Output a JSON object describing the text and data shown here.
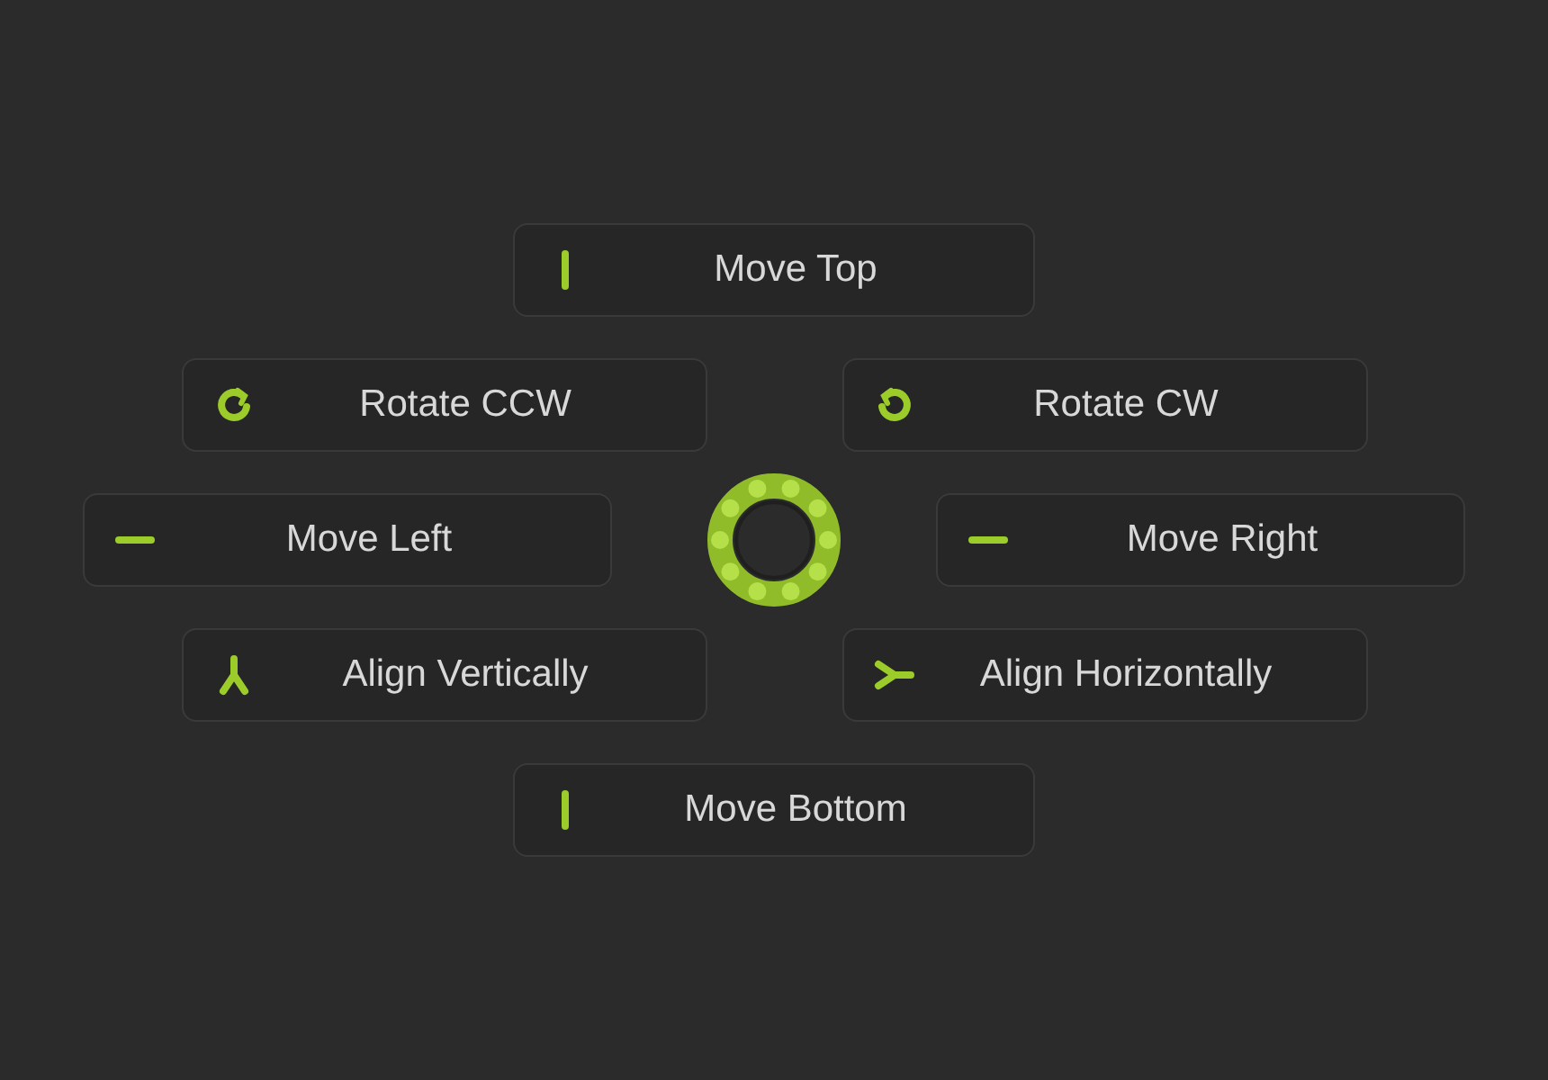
{
  "rows": [
    {
      "buttons": [
        {
          "label": "Move Top",
          "kind": "up"
        }
      ]
    },
    {
      "buttons": [
        {
          "label": "Rotate CCW",
          "kind": "ccw"
        },
        {
          "label": "Rotate CW",
          "kind": "cw"
        }
      ]
    },
    {
      "buttons": [
        {
          "label": "Move Left",
          "kind": "left"
        },
        {
          "label": "Move Right",
          "kind": "right"
        }
      ],
      "spinner": true
    },
    {
      "buttons": [
        {
          "label": "Align Vertically",
          "kind": "alignv"
        },
        {
          "label": "Align Horizontally",
          "kind": "alignh"
        }
      ]
    },
    {
      "buttons": [
        {
          "label": "Move Bottom",
          "kind": "down"
        }
      ]
    }
  ]
}
